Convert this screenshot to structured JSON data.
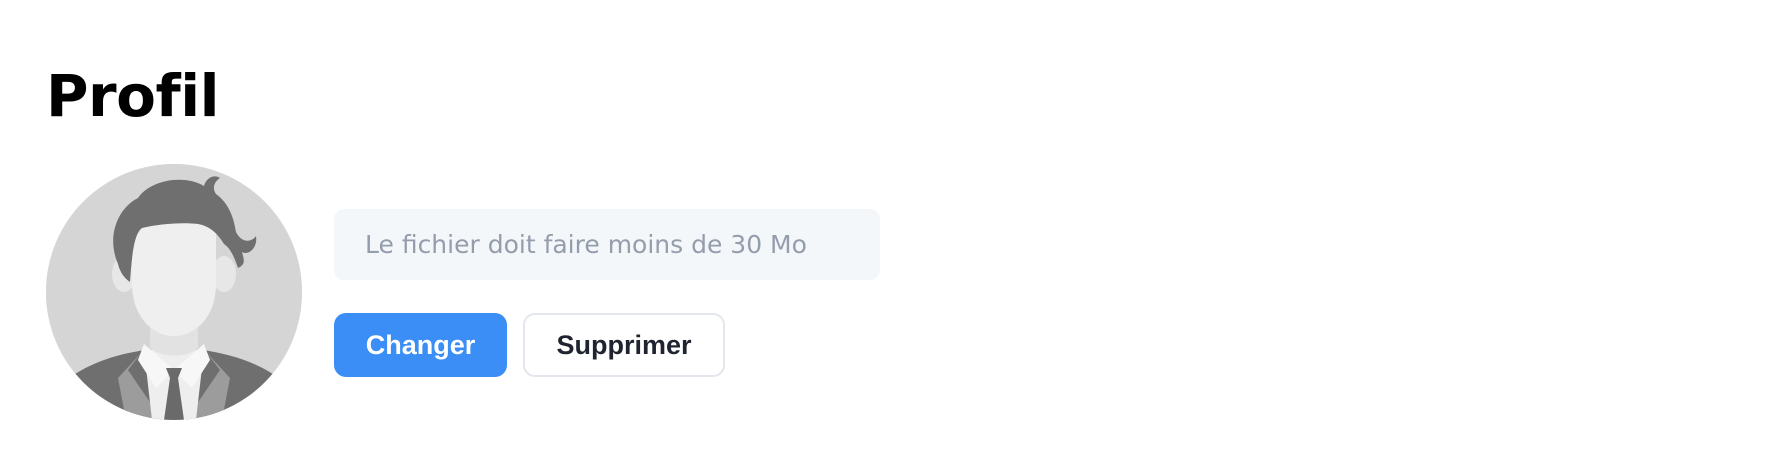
{
  "profile": {
    "title": "Profil",
    "avatar_icon": "default-male-avatar-icon",
    "file_hint": "Le fichier doit faire moins de 30 Mo",
    "change_label": "Changer",
    "delete_label": "Supprimer"
  },
  "colors": {
    "primary": "#3a8ef6",
    "hint_background": "#f4f7fa",
    "hint_text": "#949dac",
    "avatar_background": "#d5d5d5",
    "avatar_figure": "#6f6f6f"
  }
}
